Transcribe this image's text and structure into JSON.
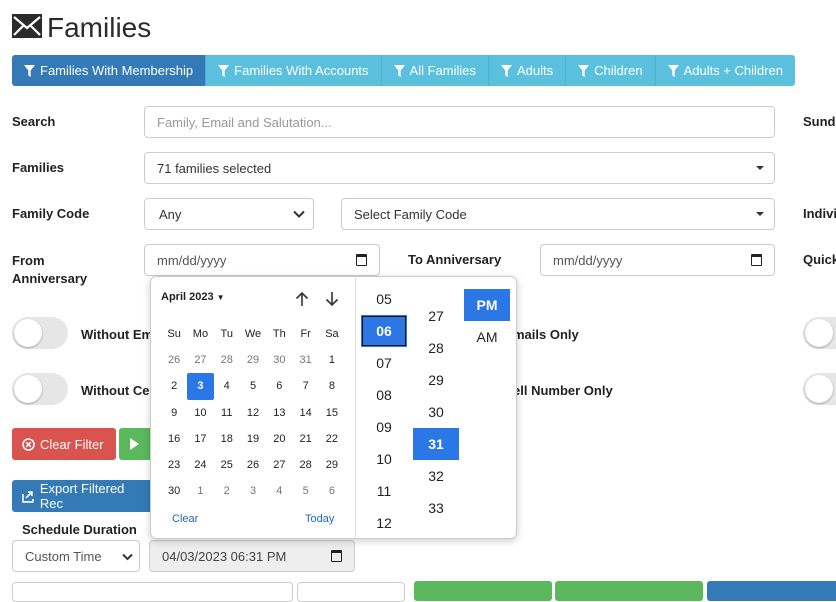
{
  "header": {
    "title": "Families"
  },
  "tabs": [
    {
      "label": "Families With Membership",
      "active": true
    },
    {
      "label": "Families With Accounts"
    },
    {
      "label": "All Families"
    },
    {
      "label": "Adults"
    },
    {
      "label": "Children"
    },
    {
      "label": "Adults + Children"
    }
  ],
  "form": {
    "search_label": "Search",
    "search_placeholder": "Family, Email and Salutation...",
    "families_label": "Families",
    "families_value": "71 families selected",
    "family_code_label": "Family Code",
    "family_code_select": "Any",
    "family_code_placeholder": "Select Family Code",
    "from_anniv_label_1": "From",
    "from_anniv_label_2": "Anniversary",
    "from_anniv_placeholder": "mm/dd/yyyy",
    "to_anniv_label": "To Anniversary",
    "to_anniv_placeholder": "mm/dd/yyyy",
    "right_sunday": "Sunda",
    "right_indiv": "Indivi",
    "right_quick": "Quick",
    "toggle1_label": "Without Em",
    "toggle1_right": "mails Only",
    "toggle2_label": "Without Cel",
    "toggle2_right": "ell Number Only"
  },
  "buttons": {
    "clear_filter": "Clear Filter",
    "export": "Export Filtered Rec"
  },
  "schedule": {
    "label": "Schedule Duration",
    "select": "Custom Time",
    "datetime": "04/03/2023 06:31 PM"
  },
  "colors": {
    "primary": "#337ab7",
    "info": "#5bc0de",
    "danger": "#d9534f",
    "success": "#5cb85c",
    "picker_sel": "#2b77e5"
  },
  "datepicker": {
    "month": "April 2023",
    "dow": [
      "Su",
      "Mo",
      "Tu",
      "We",
      "Th",
      "Fr",
      "Sa"
    ],
    "days": [
      [
        "26",
        "27",
        "28",
        "29",
        "30",
        "31",
        "1"
      ],
      [
        "2",
        "3",
        "4",
        "5",
        "6",
        "7",
        "8"
      ],
      [
        "9",
        "10",
        "11",
        "12",
        "13",
        "14",
        "15"
      ],
      [
        "16",
        "17",
        "18",
        "19",
        "20",
        "21",
        "22"
      ],
      [
        "23",
        "24",
        "25",
        "26",
        "27",
        "28",
        "29"
      ],
      [
        "30",
        "1",
        "2",
        "3",
        "4",
        "5",
        "6"
      ]
    ],
    "selected_day": "3",
    "clear": "Clear",
    "today": "Today",
    "hours": [
      "05",
      "06",
      "07",
      "08",
      "09",
      "10",
      "11",
      "12"
    ],
    "selected_hour": "06",
    "minutes": [
      "27",
      "28",
      "29",
      "30",
      "31",
      "32",
      "33"
    ],
    "selected_minute": "31",
    "ampm": [
      "PM",
      "AM"
    ],
    "selected_ampm": "PM"
  }
}
